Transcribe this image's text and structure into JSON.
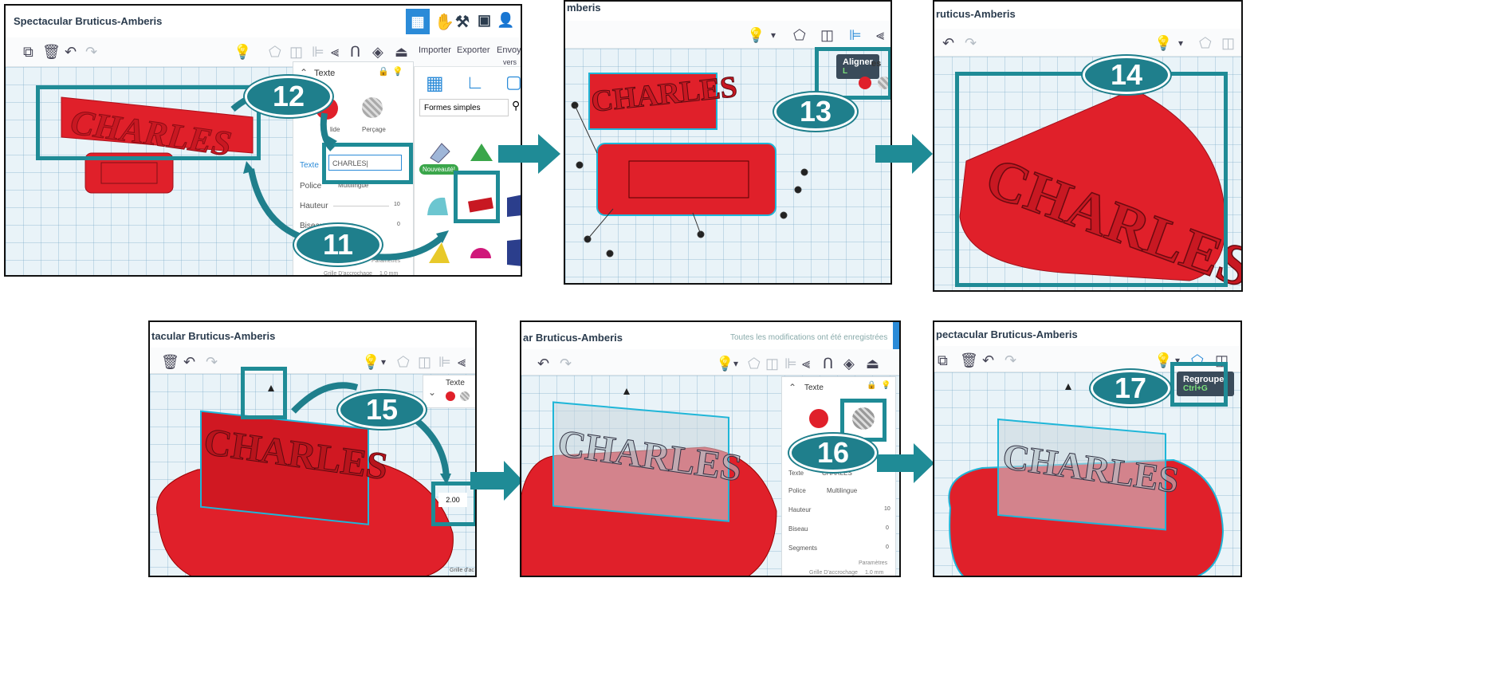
{
  "app": {
    "project_title": "Spectacular Bruticus-Amberis",
    "title_p2": "mberis",
    "title_p3": "ruticus-Amberis",
    "title_p4": "tacular Bruticus-Amberis",
    "title_p5": "ar Bruticus-Amberis",
    "title_p6": "pectacular Bruticus-Amberis",
    "save_status": "Toutes les modifications ont été enregistrées"
  },
  "steps": [
    "11",
    "12",
    "13",
    "14",
    "15",
    "16",
    "17"
  ],
  "menu": {
    "import": "Importer",
    "export": "Exporter",
    "send": "Envoyer",
    "send2": "vers"
  },
  "inspector": {
    "title": "Texte",
    "solid": "Solide",
    "solid_short": "lide",
    "hole": "Perçage",
    "text_label": "Texte",
    "text_value": "CHARLES",
    "font_label": "Police",
    "font_value": "Multilingue",
    "height_label": "Hauteur",
    "height_value": "10",
    "bevel_label": "Biseau",
    "bevel_value": "0",
    "segments_label": "Segments",
    "segments_value": "0",
    "params": "Paramètres",
    "snap_label": "Grille D'accrochage",
    "snap_value": "1.0 mm",
    "snap_short": "Grille d'ac"
  },
  "shapes_panel": {
    "category": "Formes simples",
    "new_badge": "Nouveauté!"
  },
  "tooltips": {
    "align": "Aligner",
    "align_key": "L",
    "group": "Regrouper",
    "group_key": "Ctrl+G"
  },
  "dimension_value": "2.00",
  "model_text": "CHARLES",
  "colors": {
    "accent": "#1f7f8c",
    "model_red": "#e0202a",
    "tinkercad_blue": "#2b8bd8"
  }
}
